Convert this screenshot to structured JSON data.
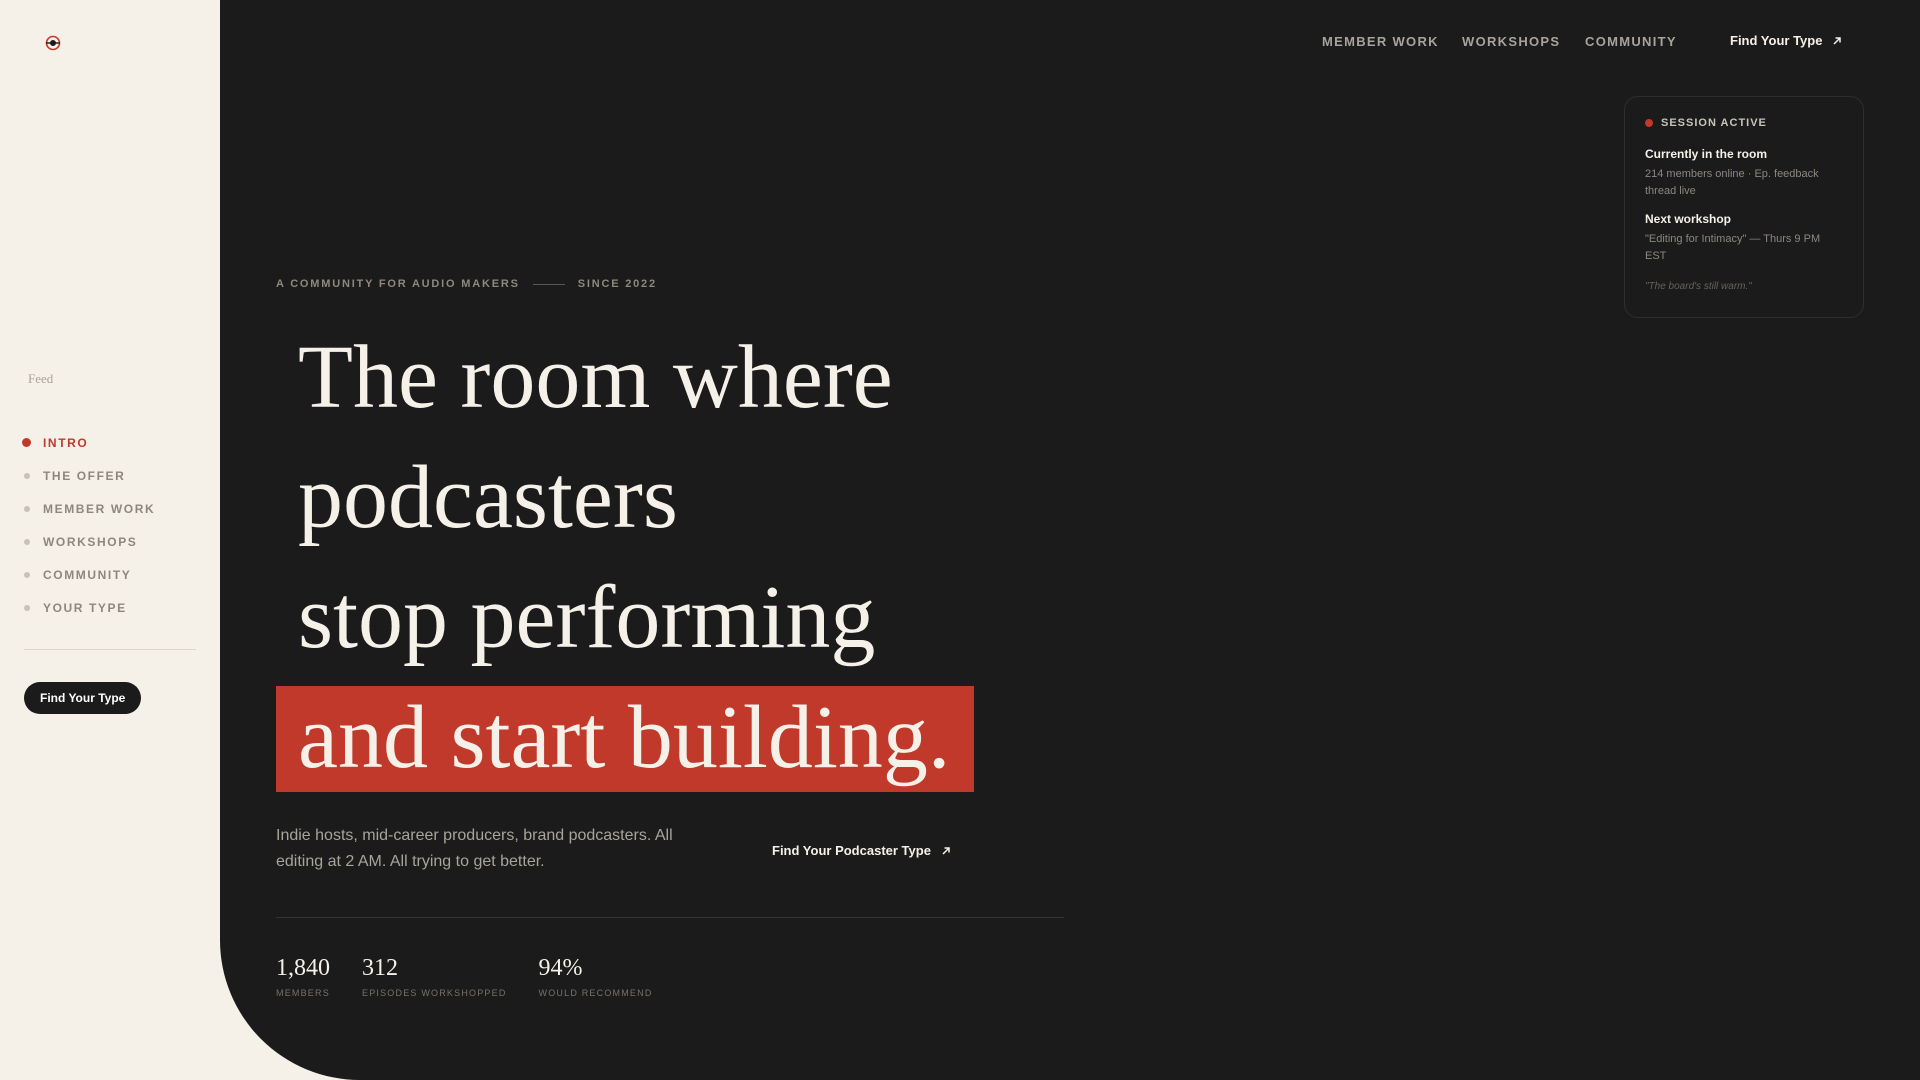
{
  "sidebar": {
    "feed_label": "Feed",
    "items": [
      {
        "label": "INTRO",
        "active": true
      },
      {
        "label": "THE OFFER",
        "active": false
      },
      {
        "label": "MEMBER WORK",
        "active": false
      },
      {
        "label": "WORKSHOPS",
        "active": false
      },
      {
        "label": "COMMUNITY",
        "active": false
      },
      {
        "label": "YOUR TYPE",
        "active": false
      }
    ],
    "cta_label": "Find Your Type"
  },
  "header": {
    "nav": [
      {
        "label": "MEMBER WORK"
      },
      {
        "label": "WORKSHOPS"
      },
      {
        "label": "COMMUNITY"
      }
    ],
    "cta_label": "Find Your Type"
  },
  "session": {
    "status": "SESSION ACTIVE",
    "room_title": "Currently in the room",
    "room_text": "214 members online · Ep. feedback thread live",
    "workshop_title": "Next workshop",
    "workshop_text": "\"Editing for Intimacy\" — Thurs 9 PM EST",
    "quote": "\"The board's still warm.\""
  },
  "hero": {
    "eyebrow_left": "A COMMUNITY FOR AUDIO MAKERS",
    "eyebrow_right": "SINCE 2022",
    "line1": "The room where",
    "line2": "podcasters",
    "line3": "stop performing",
    "line4": "and start building.",
    "subtext": "Indie hosts, mid-career producers, brand podcasters. All editing at 2 AM. All trying to get better.",
    "cta_label": "Find Your Podcaster Type"
  },
  "stats": [
    {
      "value": "1,840",
      "label": "MEMBERS"
    },
    {
      "value": "312",
      "label": "EPISODES WORKSHOPPED"
    },
    {
      "value": "94%",
      "label": "WOULD RECOMMEND"
    }
  ],
  "colors": {
    "accent": "#c0392b",
    "dark": "#1b1b1b",
    "cream": "#f5f0e8"
  }
}
